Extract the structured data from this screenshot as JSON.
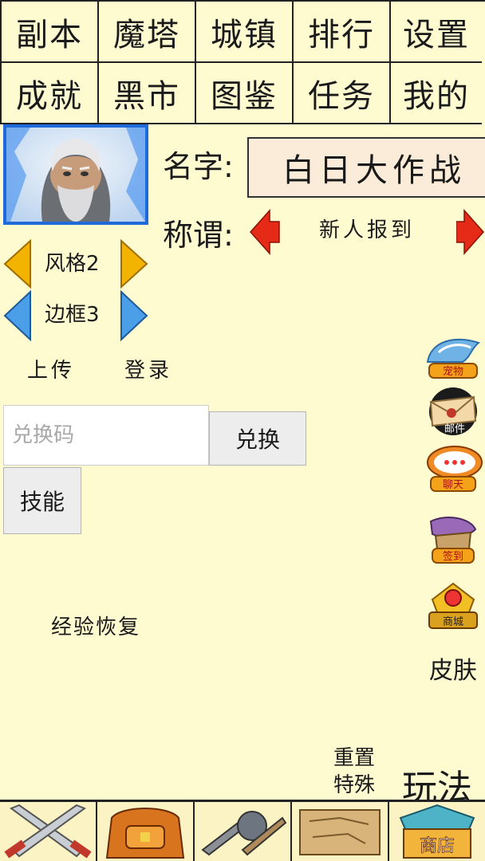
{
  "top_menu": {
    "row1": [
      "副本",
      "魔塔",
      "城镇",
      "排行",
      "设置"
    ],
    "row2": [
      "成就",
      "黑市",
      "图鉴",
      "任务",
      "我的"
    ]
  },
  "profile": {
    "name_label": "名字:",
    "name_value": "白日大作战",
    "title_label": "称谓:",
    "title_value": "新人报到"
  },
  "style_options": {
    "style_label": "风格2",
    "border_label": "边框3"
  },
  "actions": {
    "upload": "上传",
    "login": "登录",
    "redeem_placeholder": "兑换码",
    "redeem_button": "兑换",
    "skills_button": "技能",
    "exp_restore": "经验恢复",
    "reset_special_1": "重置",
    "reset_special_2": "特殊",
    "gameplay": "玩法"
  },
  "side_icons": {
    "pet": "宠物",
    "mail": "邮件",
    "chat": "聊天",
    "signin": "签到",
    "mall": "商城",
    "skin": "皮肤"
  },
  "bottom_bar": {
    "shop": "商店"
  }
}
